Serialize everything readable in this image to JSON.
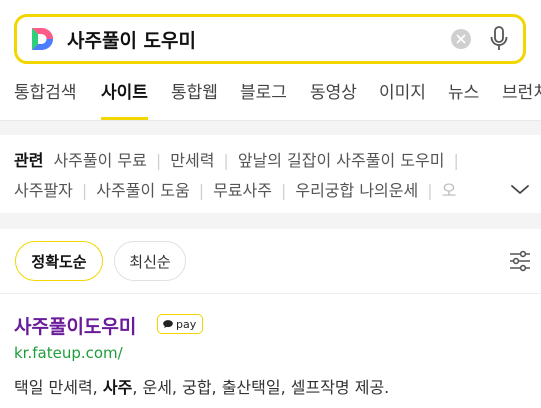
{
  "search": {
    "query": "사주풀이 도우미",
    "logo_letter": "D",
    "brand_color": "#f2d600",
    "clear_icon": "clear-icon",
    "mic_icon": "microphone-icon"
  },
  "tabs": [
    {
      "label": "통합검색",
      "active": false
    },
    {
      "label": "사이트",
      "active": true
    },
    {
      "label": "통합웹",
      "active": false
    },
    {
      "label": "블로그",
      "active": false
    },
    {
      "label": "동영상",
      "active": false
    },
    {
      "label": "이미지",
      "active": false
    },
    {
      "label": "뉴스",
      "active": false
    },
    {
      "label": "브런치",
      "active": false
    }
  ],
  "related": {
    "label": "관련",
    "row1": [
      "사주풀이 무료",
      "만세력",
      "앞날의 길잡이 사주풀이 도우미"
    ],
    "row2": [
      "사주팔자",
      "사주풀이 도움",
      "무료사주",
      "우리궁합 나의운세",
      "오"
    ],
    "expand_icon": "chevron-down-icon"
  },
  "sort": {
    "accurate": "정확도순",
    "latest": "최신순",
    "filter_icon": "filter-sliders-icon"
  },
  "result": {
    "title": "사주풀이도우미",
    "pay_label": "pay",
    "url": "kr.fateup.com/",
    "desc_pre": "택일 만세력, ",
    "desc_bold": "사주",
    "desc_post": ", 운세, 궁합, 출산택일, 셀프작명 제공.",
    "title_color": "#6a1b9a",
    "url_color": "#1e9e3a"
  }
}
